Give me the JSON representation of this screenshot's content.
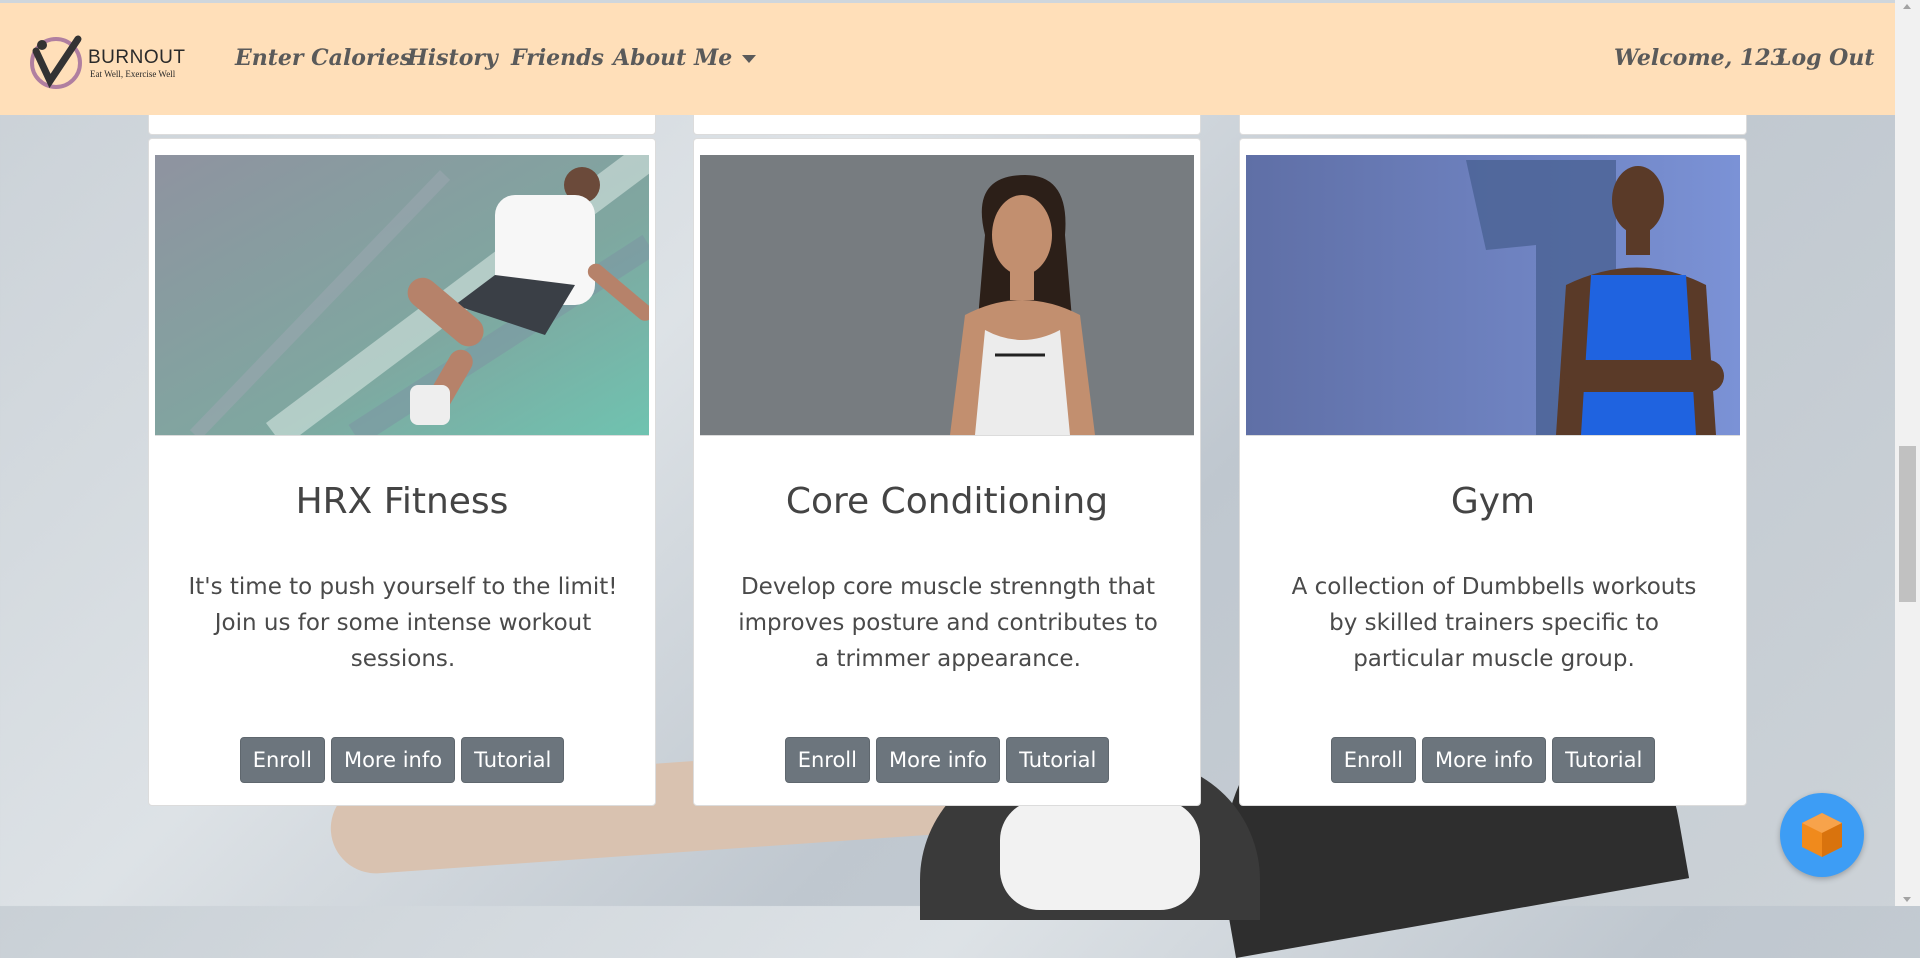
{
  "brand": {
    "name": "BURNOUT",
    "tagline": "Eat Well, Exercise Well"
  },
  "nav": {
    "links": [
      "Enter Calories",
      "History",
      "Friends",
      "About Me"
    ],
    "welcome": "Welcome, 123",
    "logout": "Log Out"
  },
  "cards": [
    {
      "title": "HRX Fitness",
      "description": "It's time to push yourself to the limit! Join us for some intense workout sessions.",
      "buttons": [
        "Enroll",
        "More info",
        "Tutorial"
      ]
    },
    {
      "title": "Core Conditioning",
      "description": "Develop core muscle strenngth that improves posture and contributes to a trimmer appearance.",
      "buttons": [
        "Enroll",
        "More info",
        "Tutorial"
      ]
    },
    {
      "title": "Gym",
      "description": "A collection of Dumbbells workouts by skilled trainers specific to particular muscle group.",
      "buttons": [
        "Enroll",
        "More info",
        "Tutorial"
      ]
    }
  ],
  "colors": {
    "navbar": "#ffdfb9",
    "button": "#6c757d",
    "fab": "#3d9df5",
    "fab_icon": "#f08a1c"
  }
}
